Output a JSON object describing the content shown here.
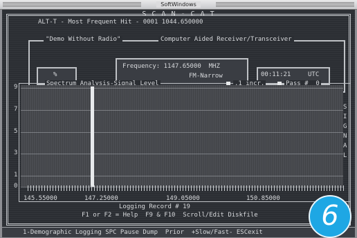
{
  "window": {
    "title": "SoftWindows"
  },
  "app": {
    "title": "S C A N - C A T",
    "status_line": "ALT-T - Most Frequent Hit - 0001 1044.650000",
    "subtitle_left": "\"Demo Without Radio\"",
    "subtitle_right": "Computer Aided Receiver/Transceiver"
  },
  "radio": {
    "left_box_label": "%",
    "frequency_line": "Frequency: 1147.65000  MHZ",
    "mode_line": "FM-Narrow",
    "clock": "00:11:21",
    "timezone": "UTC"
  },
  "spectrum": {
    "title": "Spectrum Analysis-Signal Level",
    "incr_label": ".1 incr.",
    "pass_label": "Pass #  0",
    "side_label_letters": [
      "S",
      "I",
      "G",
      "N",
      "A",
      "L"
    ],
    "y_ticks": [
      "9",
      "7",
      "5",
      "3",
      "1",
      "0"
    ],
    "x_ticks": [
      "145.55000",
      "147.25000",
      "149.05000",
      "150.85000"
    ]
  },
  "chart_data": {
    "type": "bar",
    "title": "Spectrum Analysis-Signal Level",
    "xlabel": "",
    "ylabel": "SIGNAL",
    "ylim": [
      0,
      9
    ],
    "x_ticks": [
      "145.55000",
      "147.25000",
      "149.05000",
      "150.85000"
    ],
    "series": [
      {
        "x": 146.95,
        "value": 9
      }
    ],
    "grid": true
  },
  "footer": {
    "logging": "Logging Record # 19",
    "help": "F1 or F2 = Help  F9 & F10  Scroll/Edit Diskfile",
    "bottom_bar": "1-Demographic Logging SPC Pause Dump  Prior  +Slow/Fast- ESCexit"
  },
  "badge": {
    "number": "6"
  }
}
